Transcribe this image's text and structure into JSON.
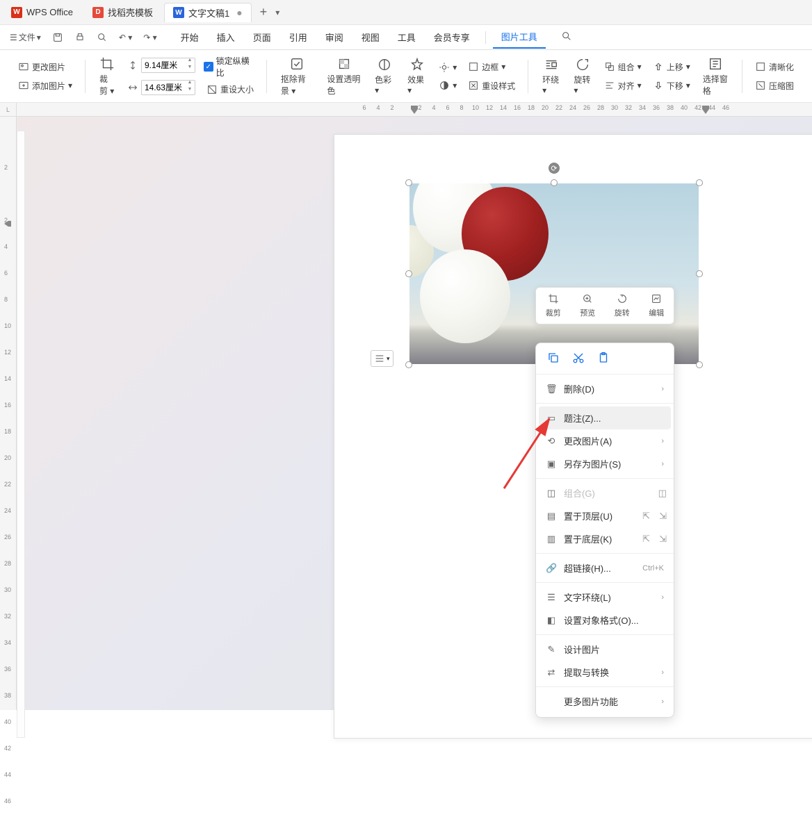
{
  "app_name": "WPS Office",
  "tabs": {
    "templates": "找稻壳模板",
    "doc": "文字文稿1"
  },
  "menubar": {
    "file": "文件",
    "start": "开始",
    "insert": "插入",
    "page": "页面",
    "ref": "引用",
    "review": "审阅",
    "view": "视图",
    "tools": "工具",
    "member": "会员专享",
    "pictools": "图片工具"
  },
  "ribbon": {
    "change_pic": "更改图片",
    "add_pic": "添加图片",
    "crop": "裁剪",
    "height": "9.14厘米",
    "width": "14.63厘米",
    "lock_ratio": "锁定纵横比",
    "reset_size": "重设大小",
    "rm_bg": "抠除背景",
    "set_alpha": "设置透明色",
    "colorize": "色彩",
    "effect": "效果",
    "border": "边框",
    "reset_style": "重设样式",
    "wrap": "环绕",
    "rotate": "旋转",
    "group": "组合",
    "align": "对齐",
    "move_up": "上移",
    "move_down": "下移",
    "sel_pane": "选择窗格",
    "clarify": "清晰化",
    "compress": "压缩图"
  },
  "float_toolbar": {
    "crop": "裁剪",
    "preview": "预览",
    "rotate": "旋转",
    "edit": "编辑"
  },
  "context_menu": {
    "delete": "删除(D)",
    "caption": "题注(Z)...",
    "change": "更改图片(A)",
    "saveas": "另存为图片(S)",
    "group": "组合(G)",
    "top": "置于顶层(U)",
    "bottom": "置于底层(K)",
    "hyperlink": "超链接(H)...",
    "hyperlink_sc": "Ctrl+K",
    "wrap": "文字环绕(L)",
    "format": "设置对象格式(O)...",
    "design": "设计图片",
    "extract": "提取与转换",
    "more": "更多图片功能"
  },
  "ruler_top": [
    "6",
    "4",
    "2",
    "",
    "2",
    "4",
    "6",
    "8",
    "10",
    "12",
    "14",
    "16",
    "18",
    "20",
    "22",
    "24",
    "26",
    "28",
    "30",
    "32",
    "34",
    "36",
    "38",
    "40",
    "42",
    "44",
    "46"
  ],
  "ruler_left": [
    "",
    "2",
    "",
    "2",
    "4",
    "6",
    "8",
    "10",
    "12",
    "14",
    "16",
    "18",
    "20",
    "22",
    "24",
    "26",
    "28",
    "30",
    "32",
    "34",
    "36",
    "38",
    "40",
    "42",
    "44",
    "46"
  ]
}
